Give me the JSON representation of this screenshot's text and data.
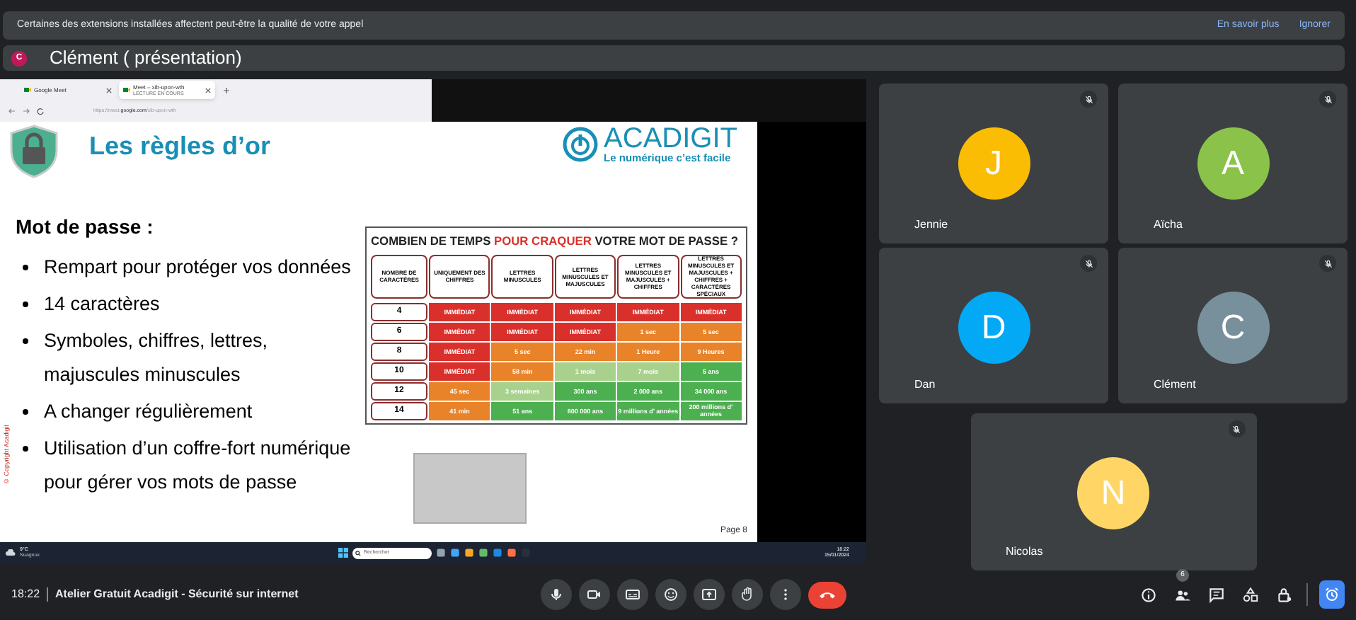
{
  "notification": {
    "message": "Certaines des extensions installées affectent peut-être la qualité de votre appel",
    "actions": [
      "En savoir plus",
      "Ignorer"
    ]
  },
  "presenter": {
    "initial": "C",
    "label": "Clément ( présentation)"
  },
  "shared_screen": {
    "browser": {
      "tabs": [
        {
          "title": "Google Meet",
          "selected": false
        },
        {
          "title": "Meet – xib-upon-wth",
          "subtitle": "LECTURE EN COURS",
          "selected": true
        }
      ],
      "url_prefix": "https://meet.",
      "url_domain": "google.com",
      "url_path": "/xib-upon-wth"
    },
    "slide": {
      "title": "Les règles d’or",
      "logo_name": "ACADIGIT",
      "logo_tagline": "Le numérique c’est facile",
      "heading": "Mot de passe :",
      "bullets": [
        "Rempart pour protéger vos données",
        "14 caractères",
        "Symboles, chiffres, lettres, majuscules minuscules",
        "A changer régulièrement",
        "Utilisation d’un coffre-fort numérique pour gérer vos mots de passe"
      ],
      "copyright": "© Copyright Acadigit",
      "page": "Page 8",
      "table": {
        "title": [
          {
            "text": "COMBIEN DE TEMPS ",
            "highlighted": false
          },
          {
            "text": "POUR CRAQUER",
            "highlighted": true
          },
          {
            "text": " VOTRE MOT DE PASSE ?",
            "highlighted": false
          }
        ],
        "columns": [
          "NOMBRE DE CARACTÈRES",
          "UNIQUEMENT DES CHIFFRES",
          "LETTRES MINUSCULES",
          "LETTRES MINUSCULES ET MAJUSCULES",
          "LETTRES MINUSCULES ET MAJUSCULES + CHIFFRES",
          "LETTRES MINUSCULES ET MAJUSCULES + CHIFFRES + CARACTÈRES SPÉCIAUX"
        ],
        "rows": [
          {
            "cells": [
              {
                "text": "4"
              },
              {
                "text": "IMMÉDIAT",
                "color": "#d9302c"
              },
              {
                "text": "IMMÉDIAT",
                "color": "#d9302c"
              },
              {
                "text": "IMMÉDIAT",
                "color": "#d9302c"
              },
              {
                "text": "IMMÉDIAT",
                "color": "#d9302c"
              },
              {
                "text": "IMMÉDIAT",
                "color": "#d9302c"
              }
            ]
          },
          {
            "cells": [
              {
                "text": "6"
              },
              {
                "text": "IMMÉDIAT",
                "color": "#d9302c"
              },
              {
                "text": "IMMÉDIAT",
                "color": "#d9302c"
              },
              {
                "text": "IMMÉDIAT",
                "color": "#d9302c"
              },
              {
                "text": "1 sec",
                "color": "#e8832a"
              },
              {
                "text": "5 sec",
                "color": "#e8832a"
              }
            ]
          },
          {
            "cells": [
              {
                "text": "8"
              },
              {
                "text": "IMMÉDIAT",
                "color": "#d9302c"
              },
              {
                "text": "5 sec",
                "color": "#e8832a"
              },
              {
                "text": "22 min",
                "color": "#e8832a"
              },
              {
                "text": "1 Heure",
                "color": "#e8832a"
              },
              {
                "text": "9 Heures",
                "color": "#e8832a"
              }
            ]
          },
          {
            "cells": [
              {
                "text": "10"
              },
              {
                "text": "IMMÉDIAT",
                "color": "#d9302c"
              },
              {
                "text": "58 min",
                "color": "#e8832a"
              },
              {
                "text": "1 mois",
                "color": "#a9d18e"
              },
              {
                "text": "7 mois",
                "color": "#a9d18e"
              },
              {
                "text": "5 ans",
                "color": "#4caf50"
              }
            ]
          },
          {
            "cells": [
              {
                "text": "12"
              },
              {
                "text": "45 sec",
                "color": "#e8832a"
              },
              {
                "text": "3 semaines",
                "color": "#a9d18e"
              },
              {
                "text": "300 ans",
                "color": "#4caf50"
              },
              {
                "text": "2 000 ans",
                "color": "#4caf50"
              },
              {
                "text": "34 000 ans",
                "color": "#4caf50"
              }
            ]
          },
          {
            "cells": [
              {
                "text": "14"
              },
              {
                "text": "41 min",
                "color": "#e8832a"
              },
              {
                "text": "51 ans",
                "color": "#4caf50"
              },
              {
                "text": "800 000 ans",
                "color": "#4caf50"
              },
              {
                "text": "9 millions d’ années",
                "color": "#4caf50"
              },
              {
                "text": "200 millions d’ années",
                "color": "#4caf50"
              }
            ]
          }
        ]
      }
    },
    "taskbar": {
      "temperature": "9°C",
      "weather": "Nuageux",
      "search_placeholder": "Rechercher",
      "time": "18:22",
      "date": "15/01/2024"
    }
  },
  "participants": [
    {
      "name": "Jennie",
      "initial": "J",
      "color": "#fbbc04",
      "muted": true
    },
    {
      "name": "Aïcha",
      "initial": "A",
      "color": "#8bc34a",
      "muted": true
    },
    {
      "name": "Dan",
      "initial": "D",
      "color": "#03a9f4",
      "muted": true
    },
    {
      "name": "Clément",
      "initial": "C",
      "color": "#78909c",
      "muted": true
    },
    {
      "name": "Nicolas",
      "initial": "N",
      "color": "#ffd666",
      "muted": true
    }
  ],
  "bottom_bar": {
    "time": "18:22",
    "meeting_title": "Atelier Gratuit Acadigit - Sécurité sur internet",
    "people_count": "6"
  }
}
